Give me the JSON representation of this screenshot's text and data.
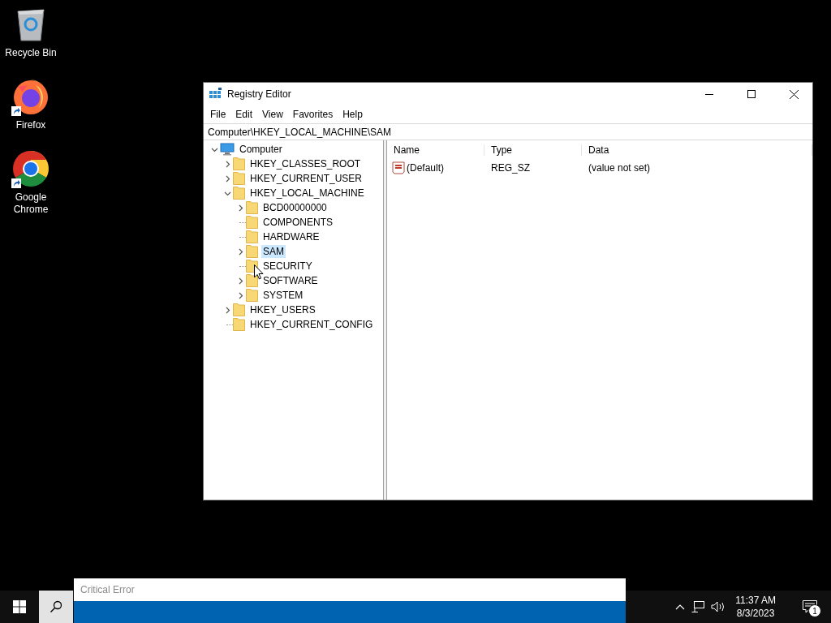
{
  "desktop_icons": [
    {
      "label": "Recycle Bin",
      "kind": "recycle",
      "shortcut": false
    },
    {
      "label": "Firefox",
      "kind": "firefox",
      "shortcut": true
    },
    {
      "label": "Google Chrome",
      "kind": "chrome",
      "shortcut": true
    }
  ],
  "window": {
    "title": "Registry Editor",
    "menu": [
      "File",
      "Edit",
      "View",
      "Favorites",
      "Help"
    ],
    "address": "Computer\\HKEY_LOCAL_MACHINE\\SAM",
    "tree": [
      {
        "label": "Computer",
        "kind": "computer",
        "expanded": true,
        "selected": false,
        "children": [
          {
            "label": "HKEY_CLASSES_ROOT",
            "kind": "branch",
            "expanded": false,
            "selected": false
          },
          {
            "label": "HKEY_CURRENT_USER",
            "kind": "branch",
            "expanded": false,
            "selected": false
          },
          {
            "label": "HKEY_LOCAL_MACHINE",
            "kind": "branch",
            "expanded": true,
            "selected": false,
            "children": [
              {
                "label": "BCD00000000",
                "kind": "branch",
                "expanded": false,
                "selected": false
              },
              {
                "label": "COMPONENTS",
                "kind": "leaf",
                "selected": false
              },
              {
                "label": "HARDWARE",
                "kind": "leaf",
                "selected": false
              },
              {
                "label": "SAM",
                "kind": "branch",
                "expanded": false,
                "selected": true
              },
              {
                "label": "SECURITY",
                "kind": "leaf",
                "selected": false
              },
              {
                "label": "SOFTWARE",
                "kind": "branch",
                "expanded": false,
                "selected": false
              },
              {
                "label": "SYSTEM",
                "kind": "branch",
                "expanded": false,
                "selected": false
              }
            ]
          },
          {
            "label": "HKEY_USERS",
            "kind": "branch",
            "expanded": false,
            "selected": false
          },
          {
            "label": "HKEY_CURRENT_CONFIG",
            "kind": "leaf",
            "selected": false
          }
        ]
      }
    ],
    "columns": [
      "Name",
      "Type",
      "Data"
    ],
    "rows": [
      {
        "name": "(Default)",
        "type": "REG_SZ",
        "data": "(value not set)"
      }
    ]
  },
  "taskbar": {
    "search_placeholder": "Critical Error",
    "time": "11:37 AM",
    "date": "8/3/2023",
    "notification_count": "1"
  }
}
